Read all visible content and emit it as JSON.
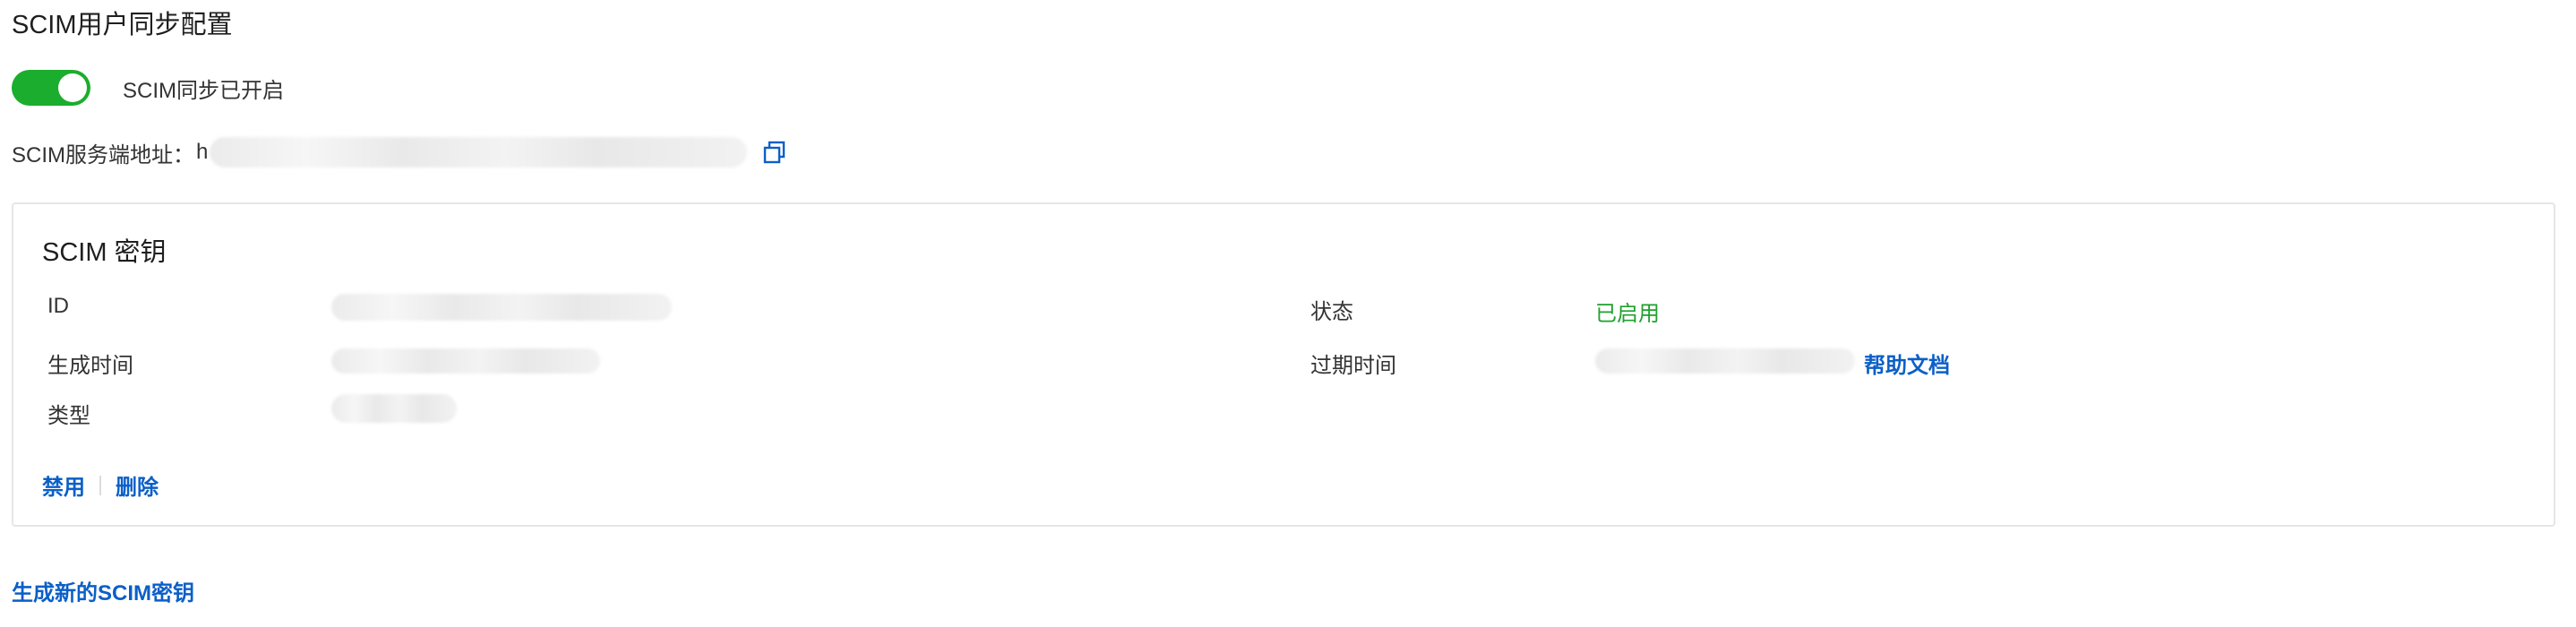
{
  "page": {
    "title": "SCIM用户同步配置"
  },
  "sync_toggle": {
    "state": "on",
    "label": "SCIM同步已开启",
    "accent_color": "#1bad2d"
  },
  "server_url": {
    "label": "SCIM服务端地址：",
    "visible_prefix": "h",
    "copy_icon": "copy-icon"
  },
  "key_card": {
    "title": "SCIM 密钥",
    "fields": {
      "id_label": "ID",
      "created_label": "生成时间",
      "type_label": "类型",
      "status_label": "状态",
      "status_value": "已启用",
      "status_color": "#1fa12e",
      "expire_label": "过期时间",
      "help_link": "帮助文档"
    },
    "actions": {
      "disable": "禁用",
      "delete": "删除"
    }
  },
  "generate_link": "生成新的SCIM密钥",
  "link_color": "#0b5fc7"
}
